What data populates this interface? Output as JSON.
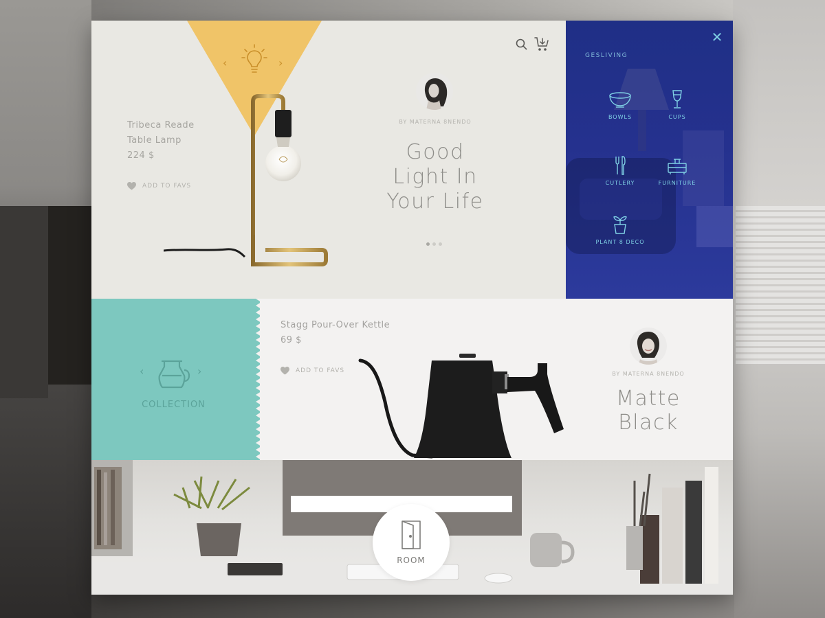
{
  "hero": {
    "product_name_line1": "Tribeca Reade",
    "product_name_line2": "Table Lamp",
    "price": "224 $",
    "add_to_favs": "ADD TO FAVS",
    "author": "BY MATERNA 8NENDO",
    "headline_line1": "Good",
    "headline_line2": "Light In",
    "headline_line3": "Your Life",
    "slide_dots": 3,
    "active_dot": 1
  },
  "sidebar": {
    "brand": "GESLIVING",
    "items": [
      {
        "label": "BOWLS",
        "icon": "bowl-icon"
      },
      {
        "label": "CUPS",
        "icon": "wine-glass-icon"
      },
      {
        "label": "CUTLERY",
        "icon": "cutlery-icon"
      },
      {
        "label": "FURNITURE",
        "icon": "furniture-icon"
      },
      {
        "label": "PLANT 8 DECO",
        "icon": "plant-icon"
      }
    ]
  },
  "collection": {
    "label": "COLLECTION",
    "icon": "coffee-pot-icon",
    "prev": "‹",
    "next": "›"
  },
  "product2": {
    "name": "Stagg Pour-Over Kettle",
    "price": "69 $",
    "add_to_favs": "ADD TO FAVS",
    "author": "BY MATERNA 8NENDO",
    "headline_line1": "Matte",
    "headline_line2": "Black"
  },
  "room": {
    "label": "ROOM",
    "icon": "door-icon"
  },
  "colors": {
    "hero_bg": "#e9e8e3",
    "accent_yellow": "#f0c468",
    "sidebar_blue": "#25318e",
    "sidebar_icon": "#7fd0e4",
    "collection_teal": "#7dc8bf",
    "kettle_bg": "#f3f2f1"
  }
}
